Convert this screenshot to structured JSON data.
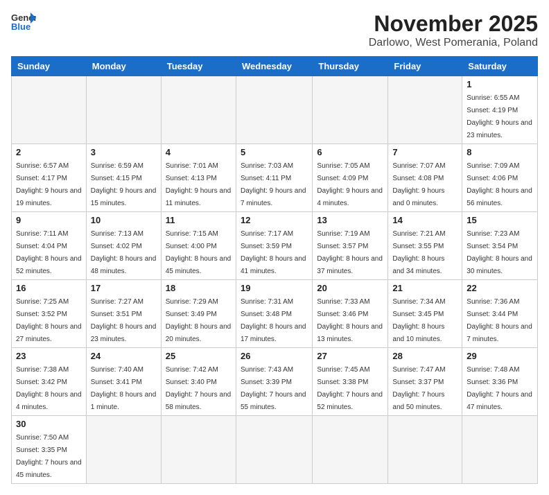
{
  "header": {
    "logo_general": "General",
    "logo_blue": "Blue",
    "month_title": "November 2025",
    "location": "Darlowo, West Pomerania, Poland"
  },
  "weekdays": [
    "Sunday",
    "Monday",
    "Tuesday",
    "Wednesday",
    "Thursday",
    "Friday",
    "Saturday"
  ],
  "days": {
    "d1": {
      "num": "1",
      "info": "Sunrise: 6:55 AM\nSunset: 4:19 PM\nDaylight: 9 hours and 23 minutes."
    },
    "d2": {
      "num": "2",
      "info": "Sunrise: 6:57 AM\nSunset: 4:17 PM\nDaylight: 9 hours and 19 minutes."
    },
    "d3": {
      "num": "3",
      "info": "Sunrise: 6:59 AM\nSunset: 4:15 PM\nDaylight: 9 hours and 15 minutes."
    },
    "d4": {
      "num": "4",
      "info": "Sunrise: 7:01 AM\nSunset: 4:13 PM\nDaylight: 9 hours and 11 minutes."
    },
    "d5": {
      "num": "5",
      "info": "Sunrise: 7:03 AM\nSunset: 4:11 PM\nDaylight: 9 hours and 7 minutes."
    },
    "d6": {
      "num": "6",
      "info": "Sunrise: 7:05 AM\nSunset: 4:09 PM\nDaylight: 9 hours and 4 minutes."
    },
    "d7": {
      "num": "7",
      "info": "Sunrise: 7:07 AM\nSunset: 4:08 PM\nDaylight: 9 hours and 0 minutes."
    },
    "d8": {
      "num": "8",
      "info": "Sunrise: 7:09 AM\nSunset: 4:06 PM\nDaylight: 8 hours and 56 minutes."
    },
    "d9": {
      "num": "9",
      "info": "Sunrise: 7:11 AM\nSunset: 4:04 PM\nDaylight: 8 hours and 52 minutes."
    },
    "d10": {
      "num": "10",
      "info": "Sunrise: 7:13 AM\nSunset: 4:02 PM\nDaylight: 8 hours and 48 minutes."
    },
    "d11": {
      "num": "11",
      "info": "Sunrise: 7:15 AM\nSunset: 4:00 PM\nDaylight: 8 hours and 45 minutes."
    },
    "d12": {
      "num": "12",
      "info": "Sunrise: 7:17 AM\nSunset: 3:59 PM\nDaylight: 8 hours and 41 minutes."
    },
    "d13": {
      "num": "13",
      "info": "Sunrise: 7:19 AM\nSunset: 3:57 PM\nDaylight: 8 hours and 37 minutes."
    },
    "d14": {
      "num": "14",
      "info": "Sunrise: 7:21 AM\nSunset: 3:55 PM\nDaylight: 8 hours and 34 minutes."
    },
    "d15": {
      "num": "15",
      "info": "Sunrise: 7:23 AM\nSunset: 3:54 PM\nDaylight: 8 hours and 30 minutes."
    },
    "d16": {
      "num": "16",
      "info": "Sunrise: 7:25 AM\nSunset: 3:52 PM\nDaylight: 8 hours and 27 minutes."
    },
    "d17": {
      "num": "17",
      "info": "Sunrise: 7:27 AM\nSunset: 3:51 PM\nDaylight: 8 hours and 23 minutes."
    },
    "d18": {
      "num": "18",
      "info": "Sunrise: 7:29 AM\nSunset: 3:49 PM\nDaylight: 8 hours and 20 minutes."
    },
    "d19": {
      "num": "19",
      "info": "Sunrise: 7:31 AM\nSunset: 3:48 PM\nDaylight: 8 hours and 17 minutes."
    },
    "d20": {
      "num": "20",
      "info": "Sunrise: 7:33 AM\nSunset: 3:46 PM\nDaylight: 8 hours and 13 minutes."
    },
    "d21": {
      "num": "21",
      "info": "Sunrise: 7:34 AM\nSunset: 3:45 PM\nDaylight: 8 hours and 10 minutes."
    },
    "d22": {
      "num": "22",
      "info": "Sunrise: 7:36 AM\nSunset: 3:44 PM\nDaylight: 8 hours and 7 minutes."
    },
    "d23": {
      "num": "23",
      "info": "Sunrise: 7:38 AM\nSunset: 3:42 PM\nDaylight: 8 hours and 4 minutes."
    },
    "d24": {
      "num": "24",
      "info": "Sunrise: 7:40 AM\nSunset: 3:41 PM\nDaylight: 8 hours and 1 minute."
    },
    "d25": {
      "num": "25",
      "info": "Sunrise: 7:42 AM\nSunset: 3:40 PM\nDaylight: 7 hours and 58 minutes."
    },
    "d26": {
      "num": "26",
      "info": "Sunrise: 7:43 AM\nSunset: 3:39 PM\nDaylight: 7 hours and 55 minutes."
    },
    "d27": {
      "num": "27",
      "info": "Sunrise: 7:45 AM\nSunset: 3:38 PM\nDaylight: 7 hours and 52 minutes."
    },
    "d28": {
      "num": "28",
      "info": "Sunrise: 7:47 AM\nSunset: 3:37 PM\nDaylight: 7 hours and 50 minutes."
    },
    "d29": {
      "num": "29",
      "info": "Sunrise: 7:48 AM\nSunset: 3:36 PM\nDaylight: 7 hours and 47 minutes."
    },
    "d30": {
      "num": "30",
      "info": "Sunrise: 7:50 AM\nSunset: 3:35 PM\nDaylight: 7 hours and 45 minutes."
    }
  }
}
